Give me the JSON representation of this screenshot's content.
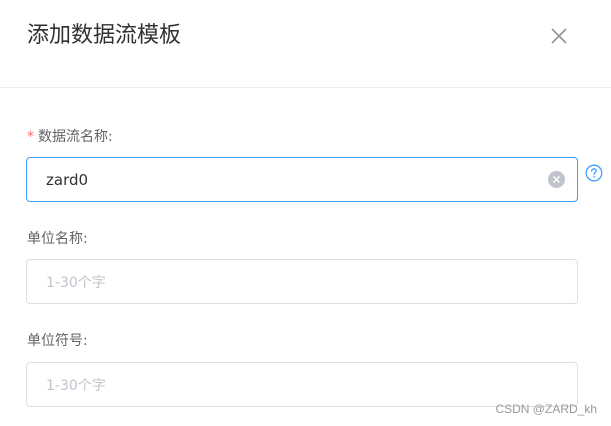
{
  "dialog": {
    "title": "添加数据流模板",
    "close_icon": "close-icon"
  },
  "form": {
    "stream_name": {
      "required_mark": "*",
      "label": "数据流名称:",
      "value": "zard0",
      "clear_icon": "circle-x-icon",
      "help_icon": "question-circle-icon"
    },
    "unit_name": {
      "label": "单位名称:",
      "value": "",
      "placeholder": "1-30个字"
    },
    "unit_symbol": {
      "label": "单位符号:",
      "value": "",
      "placeholder": "1-30个字"
    }
  },
  "watermark": "CSDN @ZARD_kh",
  "colors": {
    "accent": "#409eff",
    "required": "#f56c6c",
    "border": "#dcdfe6"
  }
}
